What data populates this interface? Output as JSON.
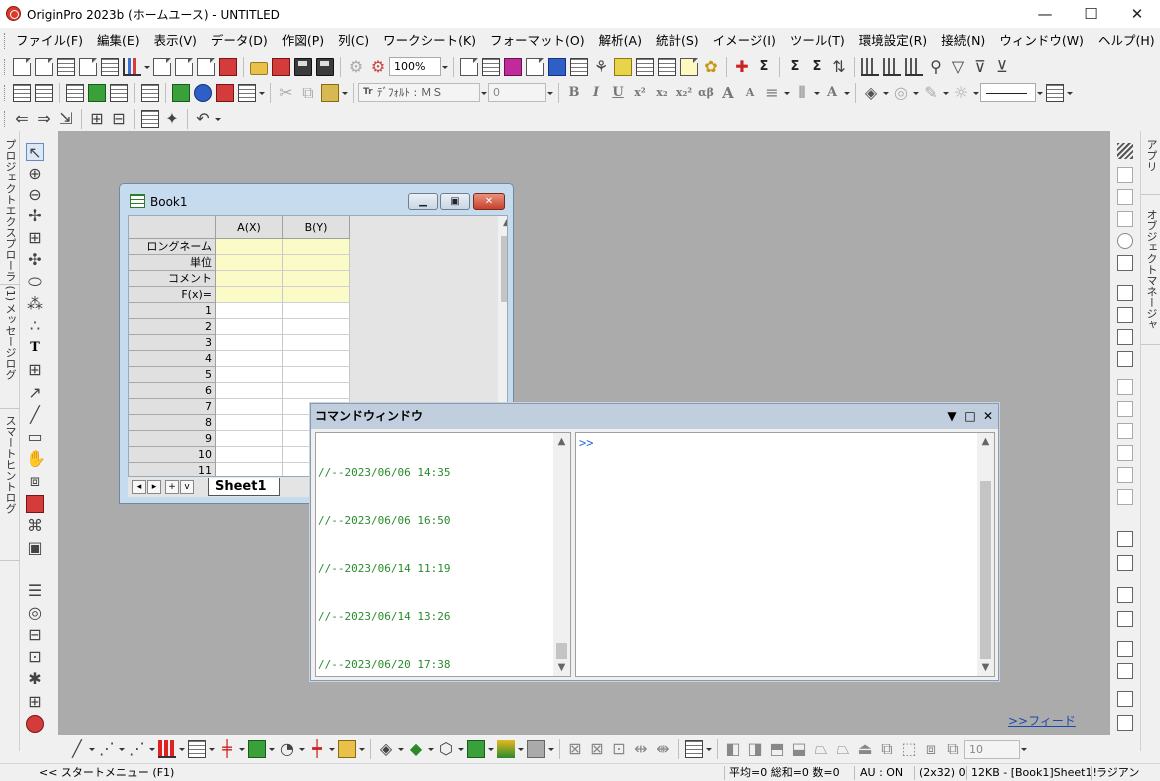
{
  "window": {
    "title": "OriginPro 2023b (ホームユース) - UNTITLED",
    "minimize": "—",
    "maximize": "☐",
    "close": "✕"
  },
  "menu": [
    "ファイル(F)",
    "編集(E)",
    "表示(V)",
    "データ(D)",
    "作図(P)",
    "列(C)",
    "ワークシート(K)",
    "フォーマット(O)",
    "解析(A)",
    "統計(S)",
    "イメージ(I)",
    "ツール(T)",
    "環境設定(R)",
    "接続(N)",
    "ウィンドウ(W)",
    "ヘルプ(H)"
  ],
  "toolbar": {
    "zoom": "100%",
    "font": "ﾃﾞﾌｫﾙﾄ : ＭＳ",
    "font_size": "0",
    "bold": "B",
    "italic": "I",
    "underline": "U",
    "superscript": "x²",
    "subscript": "x₂",
    "supersub": "x₂²",
    "greek": "αβ",
    "grow_font": "A",
    "shrink_font": "A"
  },
  "left_tabs": [
    "プロジェクトエクスプローラ (1)",
    "メッセージログ",
    "スマートヒントログ"
  ],
  "right_tabs": [
    "アプリ",
    "オブジェクトマネージャ"
  ],
  "book": {
    "title": "Book1",
    "columns": [
      "A(X)",
      "B(Y)"
    ],
    "meta_rows": [
      "ロングネーム",
      "単位",
      "コメント",
      "F(x)="
    ],
    "rows": [
      "1",
      "2",
      "3",
      "4",
      "5",
      "6",
      "7",
      "8",
      "9",
      "10",
      "11"
    ],
    "sheet_tab": "Sheet1",
    "nav": [
      "◂",
      "▸",
      "+",
      "v"
    ]
  },
  "command_window": {
    "title": "コマンドウィンドウ",
    "history": [
      "//--2023/06/06 14:35",
      "//--2023/06/06 16:50",
      "//--2023/06/14 11:19",
      "//--2023/06/14 13:26",
      "//--2023/06/20 17:38"
    ],
    "prompt": ">>"
  },
  "feed_link": ">>フィード",
  "bottom_toolbar": {
    "size_value": "10"
  },
  "status": {
    "start_menu": "<< スタートメニュー (F1)",
    "stats": "平均=0 総和=0 数=0",
    "au": "AU : ON",
    "dims": "(2x32) 0",
    "size": "12KB - [Book1]Sheet1!",
    "angle": "ラジアン"
  },
  "colors": {
    "mdi_bg": "#ababab",
    "yellow_cell": "#fbfbc7",
    "history_green": "#2a8a2a",
    "prompt_blue": "#2a6adc"
  }
}
